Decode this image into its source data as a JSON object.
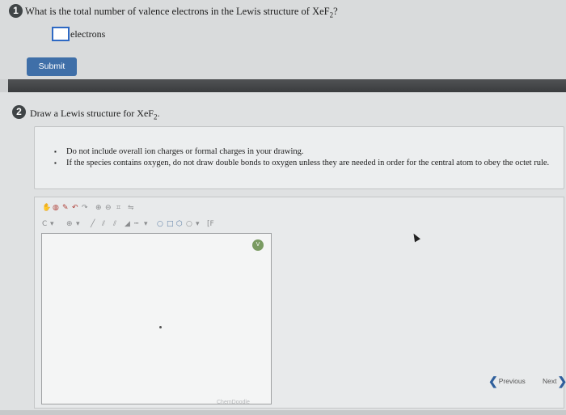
{
  "question1": {
    "number": "1",
    "prefix": "What is the total number of valence electrons in the Lewis structure of XeF",
    "subscript": "2",
    "suffix": "?",
    "answer_value": "",
    "unit_label": "electrons",
    "submit_label": "Submit"
  },
  "question2": {
    "number": "2",
    "prefix": "Draw a Lewis structure for XeF",
    "subscript": "2",
    "suffix": ".",
    "instructions": [
      "Do not include overall ion charges or formal charges in your drawing.",
      "If the species contains oxygen, do not draw double bonds to oxygen unless they are needed in order for the central atom to obey the octet rule."
    ]
  },
  "editor": {
    "badge": "V",
    "brand_label": "ChemDoodle",
    "toolbar_row2_tail": "[F"
  },
  "navigation": {
    "previous_label": "Previous",
    "next_label": "Next"
  },
  "colors": {
    "accent": "#2e69c4",
    "button": "#3f6fa8",
    "divider": "#454749"
  }
}
